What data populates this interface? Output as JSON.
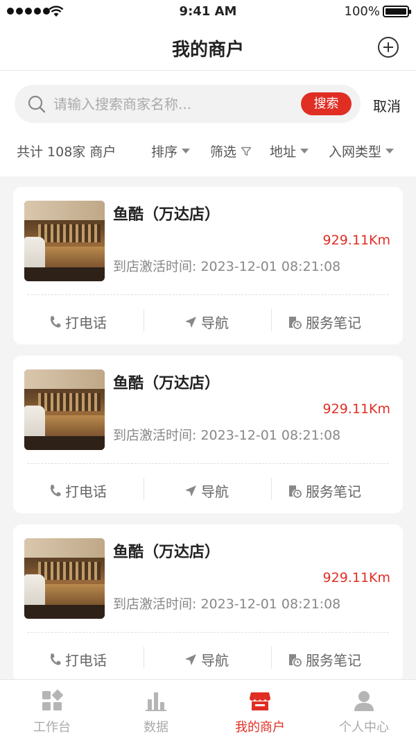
{
  "status_bar": {
    "time": "9:41 AM",
    "battery": "100%"
  },
  "header": {
    "title": "我的商户"
  },
  "search": {
    "placeholder": "请输入搜索商家名称...",
    "button_label": "搜索",
    "cancel_label": "取消"
  },
  "filter_bar": {
    "count_label": "共计 108家 商户",
    "filters": [
      {
        "label": "排序",
        "icon": "triangle-down-icon"
      },
      {
        "label": "筛选",
        "icon": "funnel-icon"
      },
      {
        "label": "地址",
        "icon": "triangle-down-icon"
      },
      {
        "label": "入网类型",
        "icon": "triangle-down-icon"
      }
    ]
  },
  "merchants": [
    {
      "name": "鱼酷（万达店）",
      "distance": "929.11Km",
      "activated_label": "到店激活时间:",
      "activated_time": "2023-12-01 08:21:08"
    },
    {
      "name": "鱼酷（万达店）",
      "distance": "929.11Km",
      "activated_label": "到店激活时间:",
      "activated_time": "2023-12-01 08:21:08"
    },
    {
      "name": "鱼酷（万达店）",
      "distance": "929.11Km",
      "activated_label": "到店激活时间:",
      "activated_time": "2023-12-01 08:21:08"
    }
  ],
  "card_actions": {
    "call": "打电话",
    "navigate": "导航",
    "notes": "服务笔记"
  },
  "tabbar": {
    "items": [
      {
        "label": "工作台",
        "icon": "dashboard-icon"
      },
      {
        "label": "数据",
        "icon": "bar-chart-icon"
      },
      {
        "label": "我的商户",
        "icon": "store-icon",
        "active": true
      },
      {
        "label": "个人中心",
        "icon": "user-icon"
      }
    ]
  },
  "colors": {
    "accent": "#e02e24",
    "inactive": "#aaaaaa"
  }
}
